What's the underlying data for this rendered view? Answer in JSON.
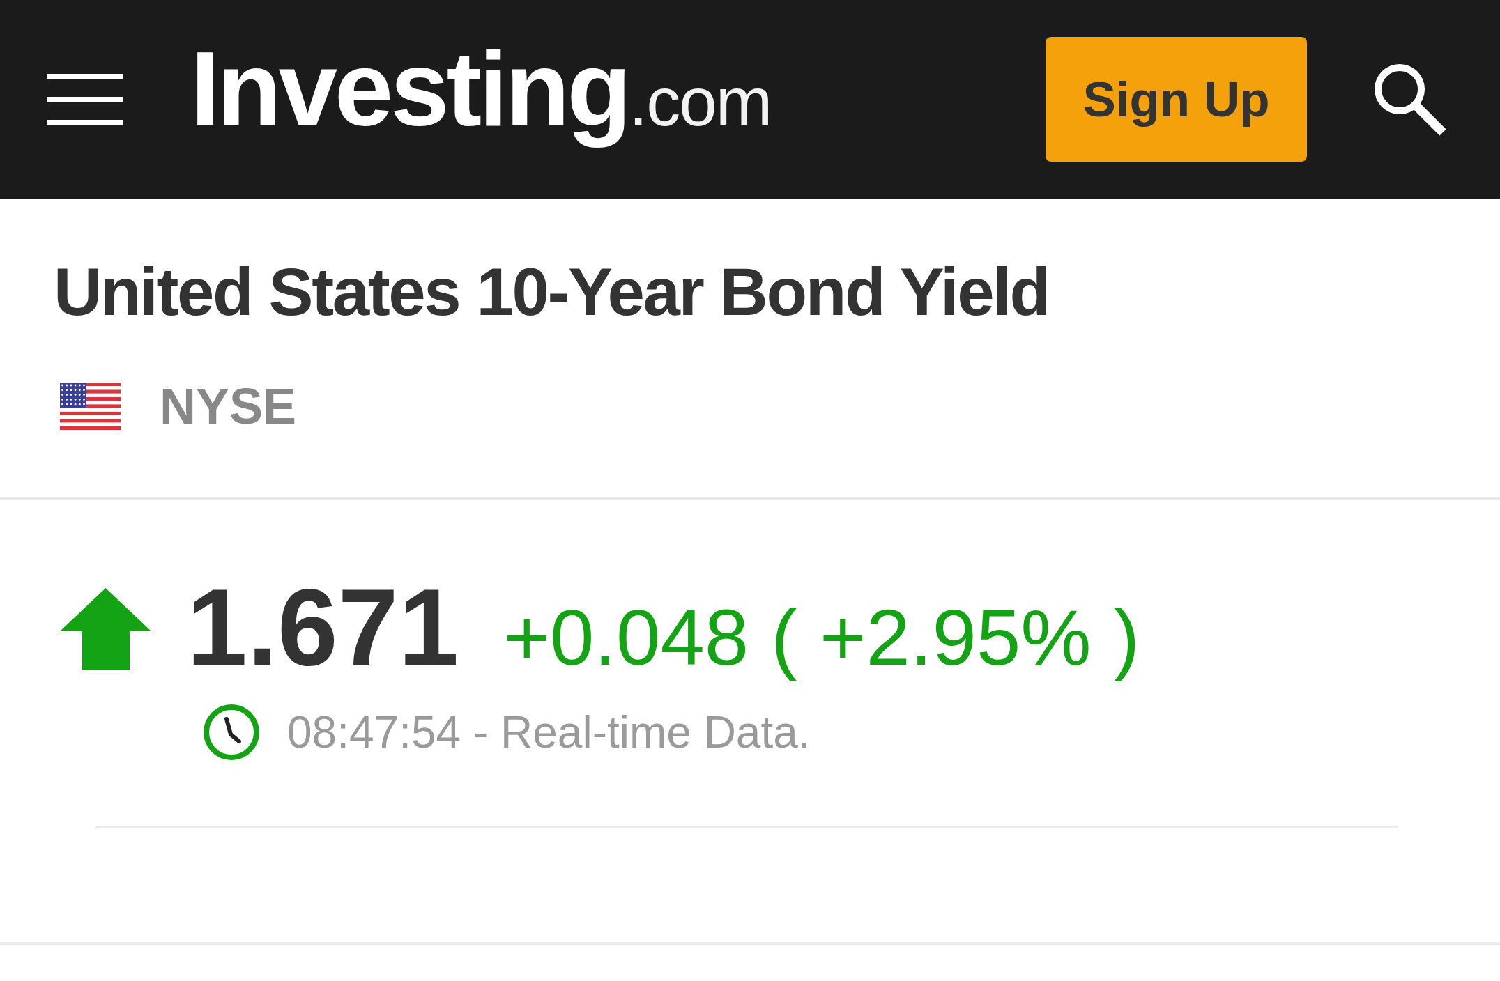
{
  "header": {
    "logo": {
      "name": "Investing",
      "suffix": ".com"
    },
    "sign_up_button": "Sign Up"
  },
  "instrument": {
    "title": "United States 10-Year Bond Yield",
    "exchange": "NYSE"
  },
  "quote": {
    "rising": true,
    "last": "1.671",
    "change": "+0.048",
    "change_percent": "( +2.95% )",
    "timestamp": "08:47:54 - Real-time Data."
  }
}
